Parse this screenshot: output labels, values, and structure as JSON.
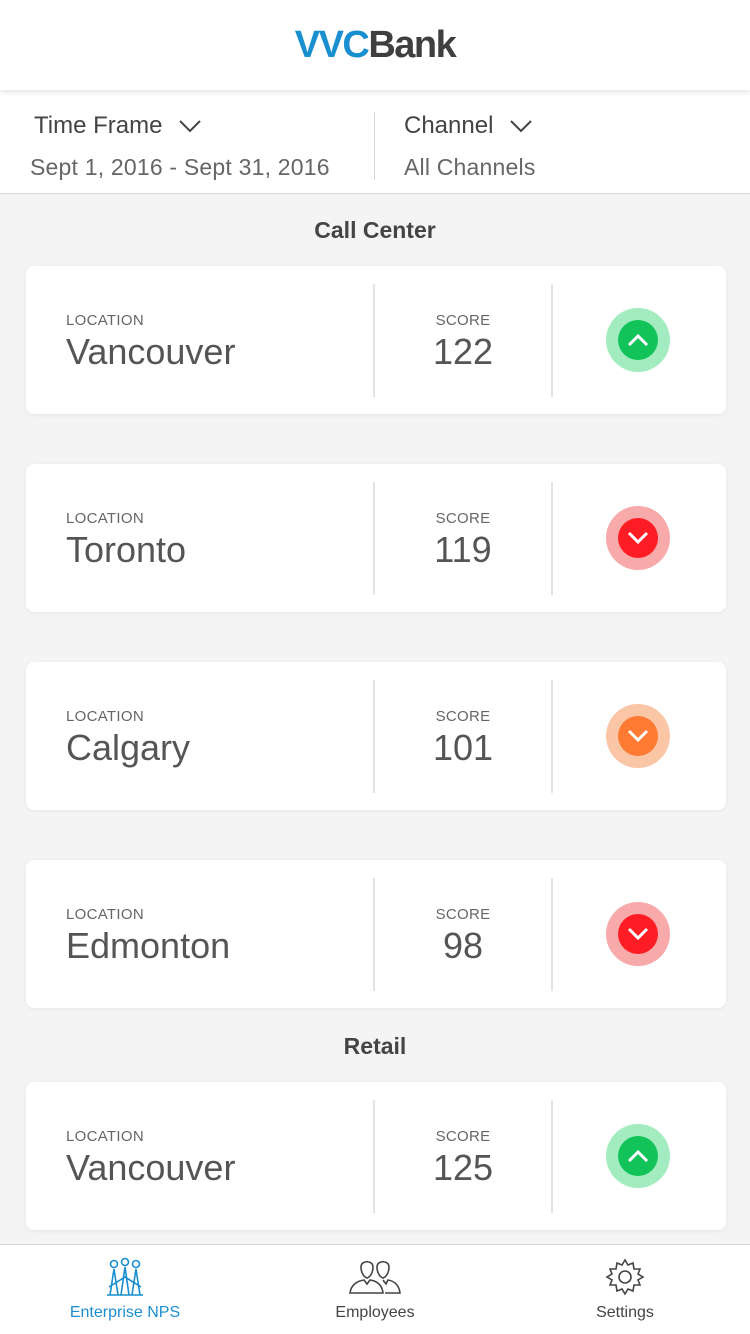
{
  "app": {
    "logo_part1": "VVC",
    "logo_part2": "Bank",
    "brand_blue": "#1a8fd0"
  },
  "filters": {
    "time_frame": {
      "label": "Time Frame",
      "value": "Sept 1, 2016 -  Sept 31, 2016",
      "icon": "chevron-down-icon"
    },
    "channel": {
      "label": "Channel",
      "value": "All Channels",
      "icon": "chevron-down-icon"
    }
  },
  "sections": [
    {
      "title": "Call Center",
      "cards": [
        {
          "location_caption": "LOCATION",
          "location": "Vancouver",
          "score_caption": "SCORE",
          "score": "122",
          "trend": "up",
          "trend_icon": "chevron-up-icon"
        },
        {
          "location_caption": "LOCATION",
          "location": "Toronto",
          "score_caption": "SCORE",
          "score": "119",
          "trend": "down",
          "trend_icon": "chevron-down-icon"
        },
        {
          "location_caption": "LOCATION",
          "location": "Calgary",
          "score_caption": "SCORE",
          "score": "101",
          "trend": "warning-down",
          "trend_icon": "chevron-down-icon"
        },
        {
          "location_caption": "LOCATION",
          "location": "Edmonton",
          "score_caption": "SCORE",
          "score": "98",
          "trend": "down",
          "trend_icon": "chevron-down-icon"
        }
      ]
    },
    {
      "title": "Retail",
      "cards": [
        {
          "location_caption": "LOCATION",
          "location": "Vancouver",
          "score_caption": "SCORE",
          "score": "125",
          "trend": "up",
          "trend_icon": "chevron-up-icon"
        }
      ]
    }
  ],
  "trend_colors": {
    "up": "#12c35a",
    "down": "#ff1d25",
    "warning-down": "#ff7a33"
  },
  "tabs": [
    {
      "label": "Enterprise NPS",
      "icon": "enterprise-nps-icon",
      "active": true
    },
    {
      "label": "Employees",
      "icon": "employees-icon",
      "active": false
    },
    {
      "label": "Settings",
      "icon": "settings-gear-icon",
      "active": false
    }
  ]
}
